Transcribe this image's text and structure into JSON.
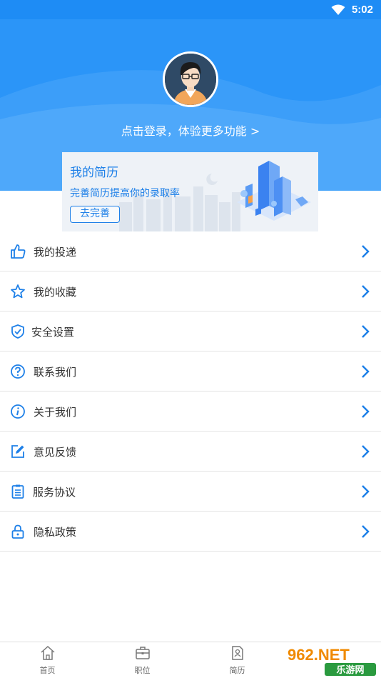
{
  "status_bar": {
    "time": "5:02"
  },
  "header": {
    "login_prompt": "点击登录，体验更多功能 >"
  },
  "resume_card": {
    "title": "我的简历",
    "subtitle": "完善简历提高你的录取率",
    "button": "去完善"
  },
  "menu": [
    {
      "label": "我的投递",
      "icon": "thumbs-up-icon"
    },
    {
      "label": "我的收藏",
      "icon": "star-icon"
    },
    {
      "label": "安全设置",
      "icon": "shield-check-icon"
    },
    {
      "label": "联系我们",
      "icon": "question-circle-icon"
    },
    {
      "label": "关于我们",
      "icon": "info-circle-icon"
    },
    {
      "label": "意见反馈",
      "icon": "edit-icon"
    },
    {
      "label": "服务协议",
      "icon": "clipboard-list-icon"
    },
    {
      "label": "隐私政策",
      "icon": "lock-icon"
    }
  ],
  "tabs": [
    {
      "label": "首页",
      "icon": "home-icon"
    },
    {
      "label": "职位",
      "icon": "briefcase-icon"
    },
    {
      "label": "简历",
      "icon": "resume-icon"
    }
  ],
  "watermark": {
    "text": "962.NET",
    "subtext": "乐游网"
  },
  "colors": {
    "primary": "#2b95f8",
    "accent_text": "#1e80e8",
    "chevron": "#1e80e8"
  }
}
